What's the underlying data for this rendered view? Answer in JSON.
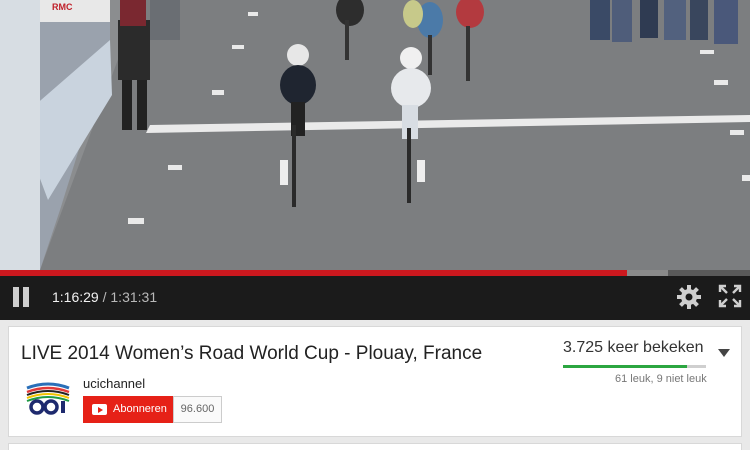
{
  "player": {
    "current_time": "1:16:29",
    "separator": "/",
    "duration": "1:31:31",
    "progress_fraction": 0.836,
    "buffered_fraction": 0.89,
    "banner_text": "RMC"
  },
  "video": {
    "title": "LIVE 2014 Women’s Road World Cup - Plouay, France",
    "views": "3.725 keer bekeken",
    "likes_text": "61 leuk, 9 niet leuk",
    "like_fraction": 0.87
  },
  "channel": {
    "name": "ucichannel",
    "subscribe_label": "Abonneren",
    "subscriber_count": "96.600"
  },
  "colors": {
    "progress": "#cc181e",
    "subscribe": "#e62117",
    "like": "#2ba640"
  },
  "icons": [
    "pause-icon",
    "gear-icon",
    "fullscreen-icon",
    "chevron-down-icon",
    "youtube-icon"
  ]
}
